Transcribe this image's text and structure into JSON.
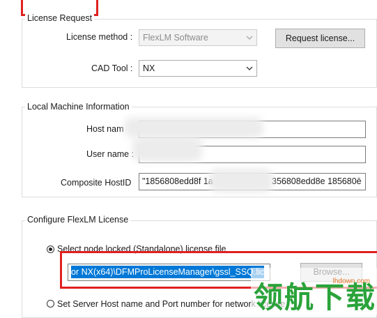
{
  "license_request": {
    "legend": "License Request",
    "method_label": "License method :",
    "method_value": "FlexLM Software",
    "request_button": "Request license...",
    "cad_label": "CAD Tool :",
    "cad_value": "NX"
  },
  "local_machine": {
    "legend": "Local Machine Information",
    "host_label": "Host nam",
    "user_label": "User name :",
    "hostid_label": "Composite HostID",
    "hostid_value_a": "\"1856808edd8f 1a",
    "hostid_value_b": "356808edd8e 185680ē"
  },
  "flexlm": {
    "legend": "Configure FlexLM License",
    "option_node_locked": "Select node locked (Standalone) license file",
    "license_path": "or NX(x64)\\DFMProLicenseManager\\gssl_SSQ.lic",
    "browse_button": "Browse...",
    "option_server": "Set Server Host name and Port number for network license"
  },
  "watermark": {
    "text": "领航下载",
    "domain": "lhdown.com"
  },
  "colors": {
    "highlight": "#e02020",
    "selection": "#0078d7"
  }
}
